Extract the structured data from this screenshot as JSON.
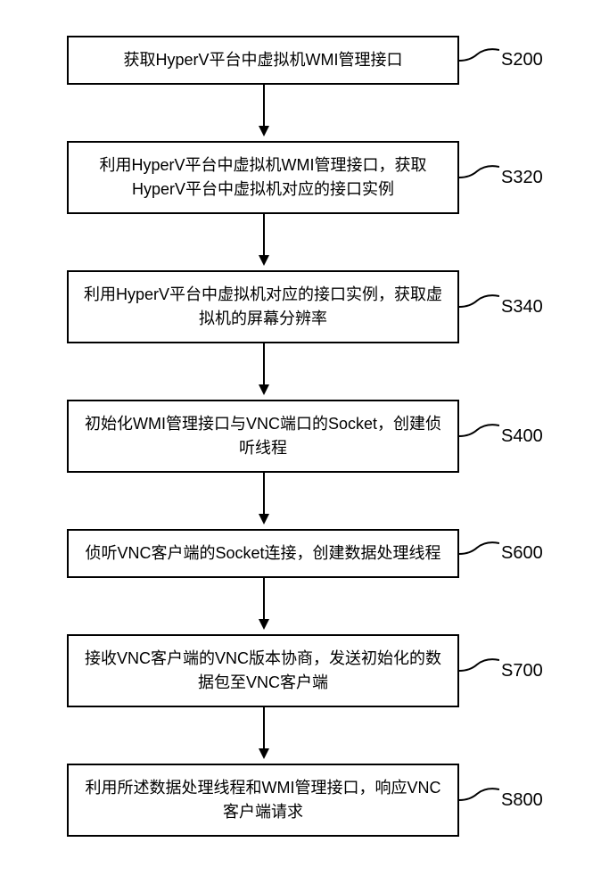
{
  "flowchart": {
    "steps": [
      {
        "id": "S200",
        "text": "获取HyperV平台中虚拟机WMI管理接口",
        "lines": 1
      },
      {
        "id": "S320",
        "text": "利用HyperV平台中虚拟机WMI管理接口，获取HyperV平台中虚拟机对应的接口实例",
        "lines": 2
      },
      {
        "id": "S340",
        "text": "利用HyperV平台中虚拟机对应的接口实例，获取虚拟机的屏幕分辨率",
        "lines": 2
      },
      {
        "id": "S400",
        "text": "初始化WMI管理接口与VNC端口的Socket，创建侦听线程",
        "lines": 1
      },
      {
        "id": "S600",
        "text": "侦听VNC客户端的Socket连接，创建数据处理线程",
        "lines": 1
      },
      {
        "id": "S700",
        "text": "接收VNC客户端的VNC版本协商，发送初始化的数据包至VNC客户端",
        "lines": 2
      },
      {
        "id": "S800",
        "text": "利用所述数据处理线程和WMI管理接口，响应VNC客户端请求",
        "lines": 1
      }
    ]
  }
}
